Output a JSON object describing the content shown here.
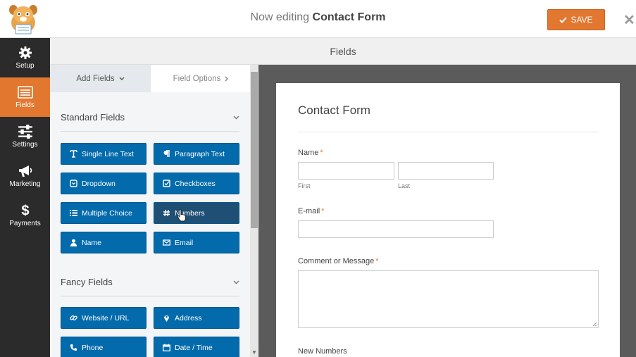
{
  "header": {
    "title_prefix": "Now editing",
    "title_name": "Contact Form",
    "save_label": "SAVE"
  },
  "leftnav": {
    "items": [
      {
        "label": "Setup",
        "icon": "gear-icon"
      },
      {
        "label": "Fields",
        "icon": "list-icon",
        "active": true
      },
      {
        "label": "Settings",
        "icon": "sliders-icon"
      },
      {
        "label": "Marketing",
        "icon": "megaphone-icon"
      },
      {
        "label": "Payments",
        "icon": "dollar-icon"
      }
    ]
  },
  "section_title": "Fields",
  "panel": {
    "tabs": {
      "add_fields": "Add Fields",
      "field_options": "Field Options"
    },
    "standard": {
      "title": "Standard Fields",
      "buttons": [
        "Single Line Text",
        "Paragraph Text",
        "Dropdown",
        "Checkboxes",
        "Multiple Choice",
        "Numbers",
        "Name",
        "Email"
      ]
    },
    "fancy": {
      "title": "Fancy Fields",
      "buttons": [
        "Website / URL",
        "Address",
        "Phone",
        "Date / Time"
      ]
    }
  },
  "form": {
    "title": "Contact Form",
    "name_label": "Name",
    "name_sub_first": "First",
    "name_sub_last": "Last",
    "email_label": "E-mail",
    "comment_label": "Comment or Message",
    "numbers_label": "New Numbers",
    "required_mark": "*"
  },
  "colors": {
    "accent": "#e27730",
    "field_button": "#036aab",
    "nav_bg": "#2b2b2b"
  }
}
